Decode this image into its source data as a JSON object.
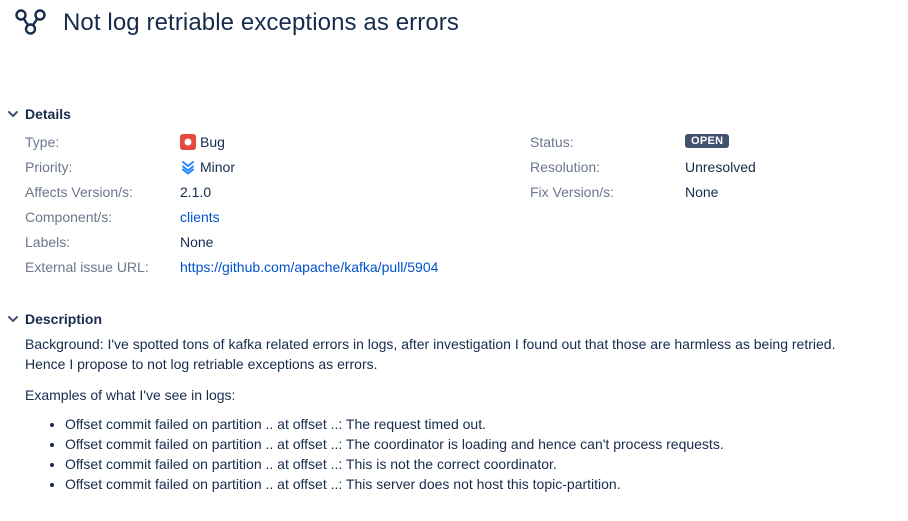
{
  "issue": {
    "title": "Not log retriable exceptions as errors"
  },
  "details": {
    "header": "Details",
    "left": [
      {
        "label": "Type:",
        "value": "Bug"
      },
      {
        "label": "Priority:",
        "value": "Minor"
      },
      {
        "label": "Affects Version/s:",
        "value": "2.1.0"
      },
      {
        "label": "Component/s:",
        "value": "clients"
      },
      {
        "label": "Labels:",
        "value": "None"
      },
      {
        "label": "External issue URL:",
        "value": "https://github.com/apache/kafka/pull/5904"
      }
    ],
    "right": [
      {
        "label": "Status:",
        "value": "OPEN"
      },
      {
        "label": "Resolution:",
        "value": "Unresolved"
      },
      {
        "label": "Fix Version/s:",
        "value": "None"
      }
    ]
  },
  "description": {
    "header": "Description",
    "paragraph1_line1": "Background: I've spotted tons of kafka related errors in logs, after investigation I found out that those are harmless as being retried.",
    "paragraph1_line2": "Hence I propose to not log retriable exceptions as errors.",
    "paragraph2": "Examples of what I've see in logs:",
    "items": [
      "Offset commit failed on partition .. at offset ..: The request timed out.",
      "Offset commit failed on partition .. at offset ..: The coordinator is loading and hence can't process requests.",
      "Offset commit failed on partition .. at offset ..: This is not the correct coordinator.",
      "Offset commit failed on partition .. at offset ..: This server does not host this topic-partition."
    ]
  },
  "colors": {
    "link": "#0052cc",
    "label": "#6b778c",
    "text": "#172b4d",
    "bug": "#e5493a",
    "priority": "#2684ff",
    "status_badge": "#42526e"
  },
  "icons": {
    "project": "project-logo-icon",
    "type": "bug-icon",
    "priority": "minor-priority-icon",
    "toggle": "chevron-down-icon"
  }
}
